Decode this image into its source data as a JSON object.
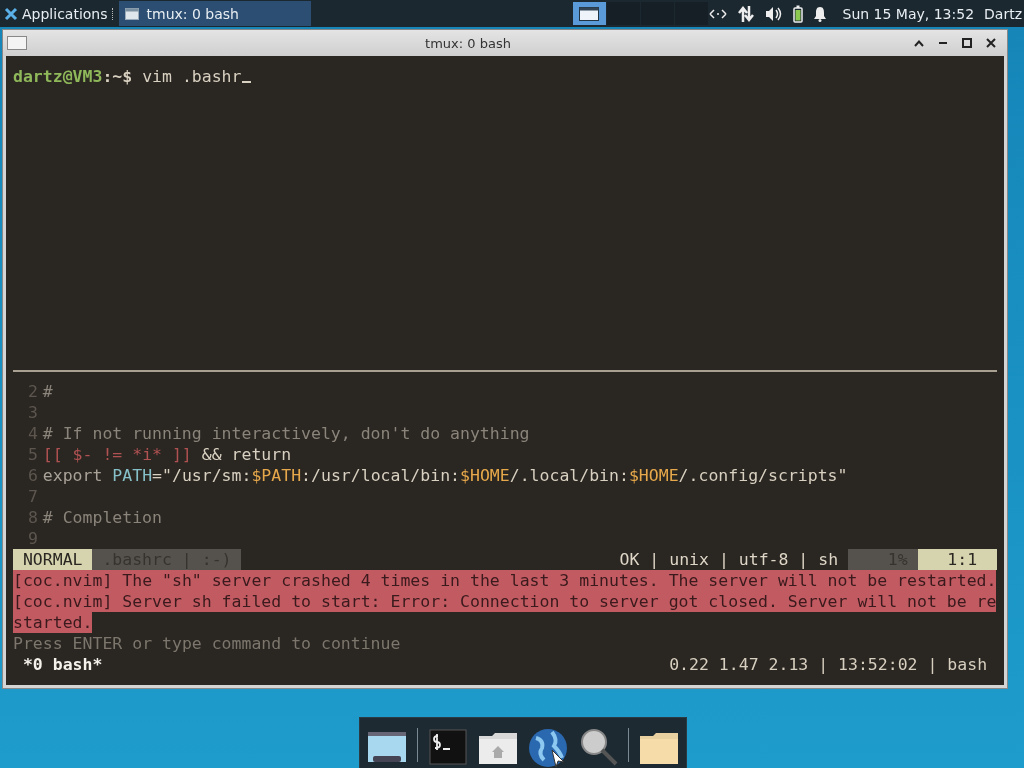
{
  "top_panel": {
    "applications_menu": "Applications",
    "tasks": [
      {
        "label": "tmux: 0 bash",
        "selected": true
      }
    ],
    "workspaces": [
      {
        "selected": true
      },
      {
        "selected": false
      },
      {
        "selected": false
      },
      {
        "selected": false
      }
    ],
    "clock": "Sun 15 May, 13:52",
    "user": "Dartz"
  },
  "window": {
    "title": "tmux: 0 bash"
  },
  "terminal": {
    "prompt_user": "dartz@VM3",
    "prompt_path": ":~$",
    "command": "vim .bashr",
    "code_lines": [
      {
        "number": "2",
        "segments": [
          {
            "text": "#",
            "kind": "comment"
          }
        ]
      },
      {
        "number": "3"
      },
      {
        "number": "4",
        "segments": [
          {
            "text": "# If not running interactively, don't do anything",
            "kind": "comment"
          }
        ]
      },
      {
        "number": "5",
        "segments": [
          {
            "text": "[[ ",
            "kind": "bracket"
          },
          {
            "text": "$- != *i* ",
            "kind": "bracket"
          },
          {
            "text": "]]",
            "kind": "bracket"
          },
          {
            "text": " && return",
            "kind": "plain"
          }
        ]
      },
      {
        "number": "6",
        "segments": [
          {
            "text": "export ",
            "kind": "keyword"
          },
          {
            "text": "PATH",
            "kind": "ident"
          },
          {
            "text": "=\"/usr/sm:",
            "kind": "plain"
          },
          {
            "text": "$PATH",
            "kind": "variable"
          },
          {
            "text": ":/usr/local/bin:",
            "kind": "plain"
          },
          {
            "text": "$HOME",
            "kind": "variable"
          },
          {
            "text": "/.local/bin:",
            "kind": "plain"
          },
          {
            "text": "$HOME",
            "kind": "variable"
          },
          {
            "text": "/.config/scripts\"",
            "kind": "plain"
          }
        ]
      },
      {
        "number": "7"
      },
      {
        "number": "8",
        "segments": [
          {
            "text": "# Completion",
            "kind": "comment"
          }
        ]
      },
      {
        "number": "9"
      }
    ],
    "statusline": {
      "mode": "NORMAL",
      "file": ".bashrc | :-)",
      "info": "OK | unix | utf-8 | sh",
      "percent": "1%",
      "position": "1:1"
    },
    "messages": [
      {
        "text": "[coc.nvim] The \"sh\" server crashed 4 times in the last 3 minutes. The server will not be restarted.",
        "kind": "error"
      },
      {
        "text": "[coc.nvim] Server sh failed to start: Error: Connection to server got closed. Server will not be re",
        "kind": "error"
      },
      {
        "text": "started.",
        "kind": "error"
      },
      {
        "text": "Press ENTER or type command to continue",
        "kind": "prompt"
      }
    ],
    "tmux_status": {
      "window": "*0 bash*",
      "info": "0.22 1.47 2.13 | 13:52:02 | bash"
    }
  },
  "dock": {
    "items": [
      {
        "kind": "desktop"
      },
      {
        "kind": "terminal"
      },
      {
        "kind": "home"
      },
      {
        "kind": "globe"
      },
      {
        "kind": "search"
      },
      {
        "kind": "folder"
      }
    ]
  }
}
